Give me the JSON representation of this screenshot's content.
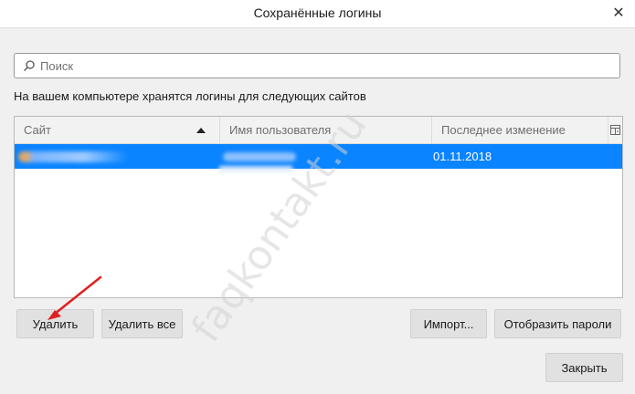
{
  "window": {
    "title": "Сохранённые логины",
    "close_icon": "close-icon"
  },
  "search": {
    "placeholder": "Поиск",
    "value": "",
    "icon": "search-icon"
  },
  "description": "На вашем компьютере хранятся логины для следующих сайтов",
  "table": {
    "columns": [
      "Сайт",
      "Имя пользователя",
      "Последнее изменение"
    ],
    "sort_column": "Сайт",
    "sort_direction": "ascending",
    "rows": [
      {
        "site": "",
        "username": "",
        "last_changed": "01.11.2018",
        "selected": true
      }
    ]
  },
  "buttons": {
    "delete": "Удалить",
    "delete_all": "Удалить все",
    "import": "Импорт...",
    "show_passwords": "Отобразить пароли",
    "close": "Закрыть"
  },
  "watermark": "faqkontakt.ru",
  "colors": {
    "selection": "#0a84ff",
    "annotation_arrow": "#e02020"
  }
}
